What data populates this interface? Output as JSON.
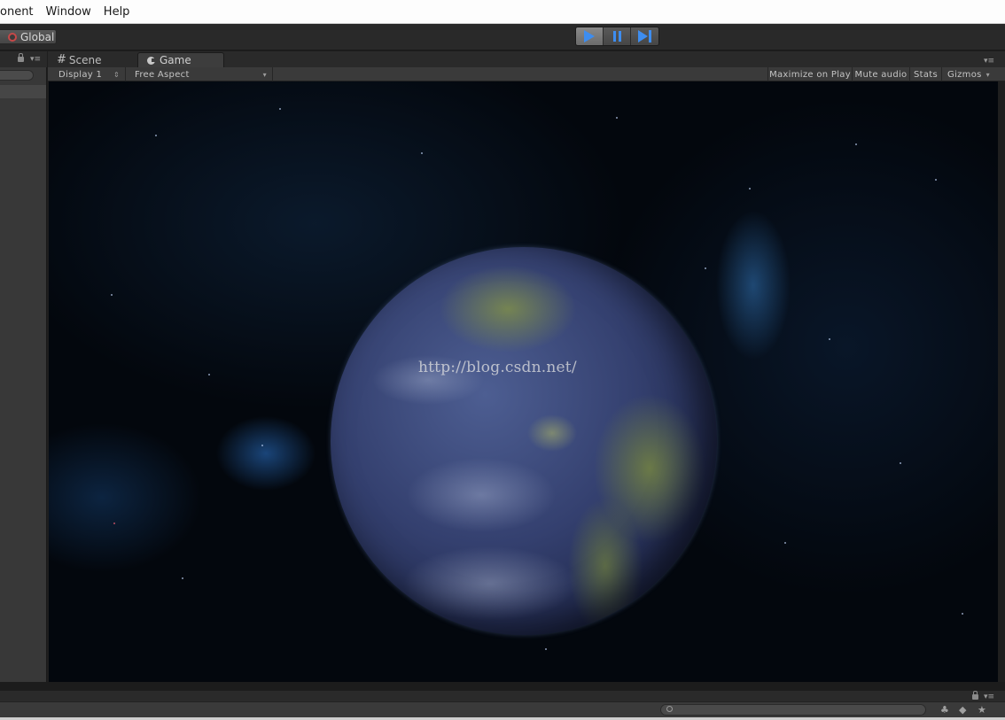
{
  "menubar": {
    "items": [
      "onent",
      "Window",
      "Help"
    ]
  },
  "toolbar": {
    "global_label": "Global",
    "play_active": true
  },
  "game_view": {
    "tabs": [
      {
        "label": "Scene",
        "icon": "grid-icon"
      },
      {
        "label": "Game",
        "icon": "pacman-icon",
        "active": true
      }
    ],
    "display_dropdown": "Display 1",
    "aspect_dropdown": "Free Aspect",
    "buttons": {
      "maximize_on_play": "Maximize on Play",
      "mute_audio": "Mute audio",
      "stats": "Stats",
      "gizmos": "Gizmos"
    },
    "watermark": "http://blog.csdn.net/"
  },
  "colors": {
    "play_blue": "#3d8df0",
    "editor_bg": "#383838",
    "space_bg": "#03070d"
  }
}
